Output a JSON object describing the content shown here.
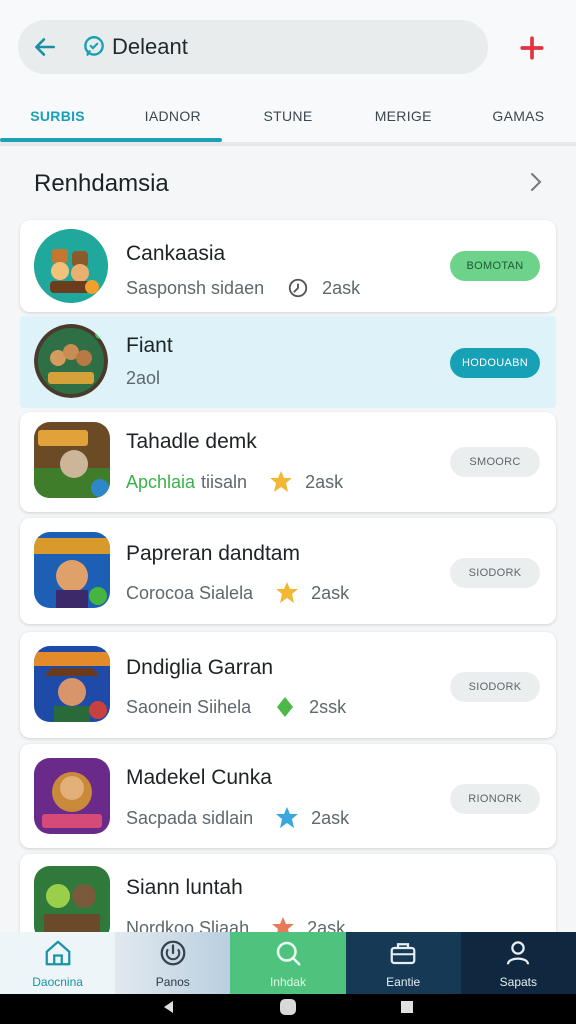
{
  "colors": {
    "accent": "#16a1b7",
    "green_pill": "#6ed38a",
    "grey_pill": "#ebeeef",
    "highlight_row": "#ddf3f9"
  },
  "header": {
    "title": "Deleant",
    "back_icon": "arrow-left-icon",
    "brand_icon": "chat-badge-icon",
    "action_icon": "plus-icon"
  },
  "tabs": [
    {
      "label": "SURBIS",
      "active": true
    },
    {
      "label": "IADNOR",
      "active": false
    },
    {
      "label": "STUNE",
      "active": false
    },
    {
      "label": "MERIGE",
      "active": false
    },
    {
      "label": "GAMAS",
      "active": false
    }
  ],
  "section": {
    "title": "Renhdamsia",
    "chevron_icon": "chevron-right-icon"
  },
  "apps": [
    {
      "name": "Cankaasia",
      "meta_prefix": "",
      "meta_text": "Sasponsh sidaen",
      "meta_icon": "clock-icon",
      "meta_value": "2ask",
      "button": "BOMOTAN",
      "button_style": "green"
    },
    {
      "name": "Fiant",
      "meta_prefix": "",
      "meta_text": "2aol",
      "meta_icon": "",
      "meta_value": "",
      "button": "HODOUABN",
      "button_style": "teal"
    },
    {
      "name": "Tahadle demk",
      "meta_prefix": "Apchlaia",
      "meta_text": "tiisaln",
      "meta_icon": "star-burst-icon",
      "meta_value": "2ask",
      "button": "SMOORC",
      "button_style": "grey"
    },
    {
      "name": "Papreran dandtam",
      "meta_prefix": "",
      "meta_text": "Corocoa Sialela",
      "meta_icon": "star-burst-icon",
      "meta_value": "2ask",
      "button": "SIODORK",
      "button_style": "grey"
    },
    {
      "name": "Dndiglia Garran",
      "meta_prefix": "",
      "meta_text": "Saonein Siihela",
      "meta_icon": "leaf-icon",
      "meta_value": "2ssk",
      "button": "SIODORK",
      "button_style": "grey"
    },
    {
      "name": "Madekel Cunka",
      "meta_prefix": "",
      "meta_text": "Sacpada sidlain",
      "meta_icon": "blue-star-icon",
      "meta_value": "2ask",
      "button": "RIONORK",
      "button_style": "grey"
    },
    {
      "name": "Siann luntah",
      "meta_prefix": "",
      "meta_text": "Nordkoo Sliaah",
      "meta_icon": "star-burst-icon",
      "meta_value": "2ask",
      "button": "",
      "button_style": "grey"
    }
  ],
  "bottom_nav": [
    {
      "label": "Daocnina",
      "icon": "home-icon"
    },
    {
      "label": "Panos",
      "icon": "power-icon"
    },
    {
      "label": "Inhdak",
      "icon": "search-icon"
    },
    {
      "label": "Eantie",
      "icon": "briefcase-icon"
    },
    {
      "label": "Sapats",
      "icon": "person-icon"
    }
  ]
}
